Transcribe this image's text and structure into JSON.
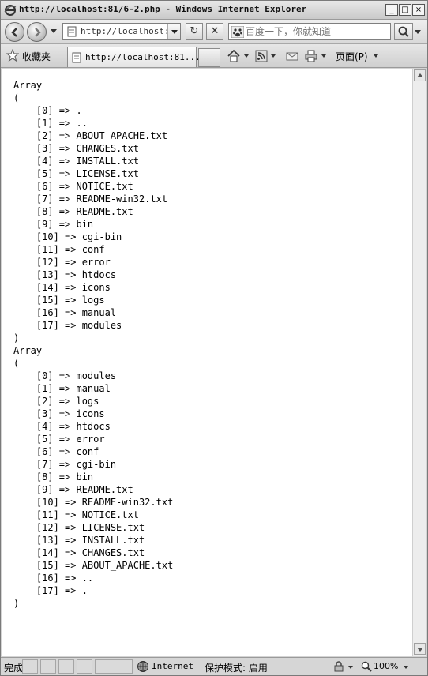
{
  "window": {
    "title": "http://localhost:81/6-2.php - Windows Internet Explorer",
    "minimize_glyph": "_",
    "maximize_glyph": "□",
    "close_glyph": "×"
  },
  "navbar": {
    "address": "http://localhost:81/6-2.php",
    "search_placeholder": "百度一下，你就知道",
    "refresh_glyph": "↻",
    "stop_glyph": "✕"
  },
  "favbar": {
    "favorites_label": "收藏夹",
    "tab_title": "http://localhost:81...",
    "page_menu_label": "页面(P)"
  },
  "content": {
    "output": "Array\n(\n    [0] => .\n    [1] => ..\n    [2] => ABOUT_APACHE.txt\n    [3] => CHANGES.txt\n    [4] => INSTALL.txt\n    [5] => LICENSE.txt\n    [6] => NOTICE.txt\n    [7] => README-win32.txt\n    [8] => README.txt\n    [9] => bin\n    [10] => cgi-bin\n    [11] => conf\n    [12] => error\n    [13] => htdocs\n    [14] => icons\n    [15] => logs\n    [16] => manual\n    [17] => modules\n)\nArray\n(\n    [0] => modules\n    [1] => manual\n    [2] => logs\n    [3] => icons\n    [4] => htdocs\n    [5] => error\n    [6] => conf\n    [7] => cgi-bin\n    [8] => bin\n    [9] => README.txt\n    [10] => README-win32.txt\n    [11] => NOTICE.txt\n    [12] => LICENSE.txt\n    [13] => INSTALL.txt\n    [14] => CHANGES.txt\n    [15] => ABOUT_APACHE.txt\n    [16] => ..\n    [17] => .\n)"
  },
  "statusbar": {
    "status": "完成",
    "zone": "Internet",
    "protected_mode": "保护模式: 启用",
    "zoom": "100%"
  },
  "icons": [
    "ie-logo-icon",
    "back-arrow-icon",
    "forward-arrow-icon",
    "page-icon",
    "refresh-icon",
    "stop-icon",
    "baidu-paw-icon",
    "search-icon",
    "star-icon",
    "home-icon",
    "feeds-icon",
    "mail-icon",
    "print-icon",
    "globe-icon",
    "lock-icon",
    "zoom-icon"
  ],
  "colors": {
    "chrome": "#d4d4d4",
    "content_bg": "#ffffff"
  }
}
